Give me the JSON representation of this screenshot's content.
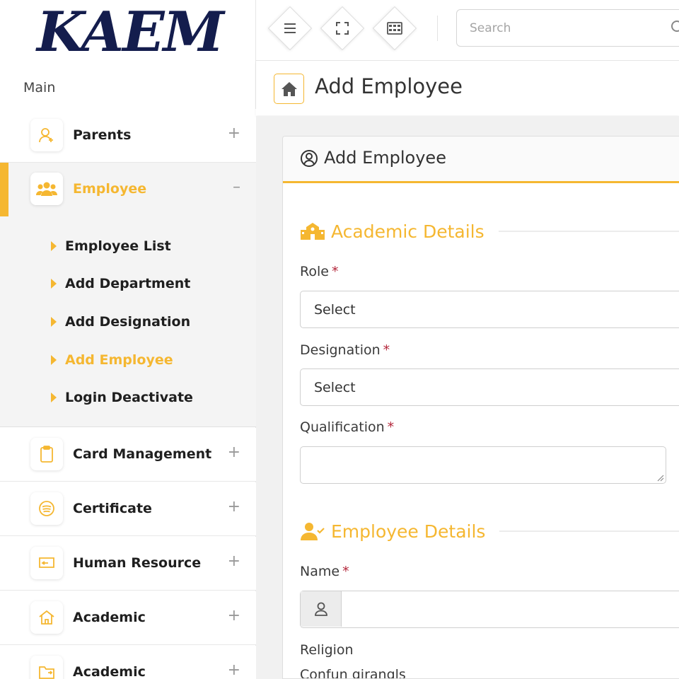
{
  "brand": {
    "logo_text": "KAEM"
  },
  "sidebar": {
    "section_label": "Main",
    "items": [
      {
        "label": "Parents",
        "toggle": "+"
      },
      {
        "label": "Employee",
        "toggle": "–"
      },
      {
        "label": "Card Management",
        "toggle": "+"
      },
      {
        "label": "Certificate",
        "toggle": "+"
      },
      {
        "label": "Human Resource",
        "toggle": "+"
      },
      {
        "label": "Academic",
        "toggle": "+"
      },
      {
        "label": "Academic",
        "toggle": "+"
      }
    ],
    "employee_submenu": [
      {
        "label": "Employee List"
      },
      {
        "label": "Add Department"
      },
      {
        "label": "Add Designation"
      },
      {
        "label": "Add Employee",
        "active": true
      },
      {
        "label": "Login Deactivate"
      }
    ]
  },
  "topbar": {
    "icons": [
      "menu-icon",
      "fullscreen-icon",
      "grid-icon"
    ],
    "search": {
      "placeholder": "Search",
      "value": ""
    }
  },
  "page": {
    "title": "Add Employee"
  },
  "form": {
    "card_title": "Add Employee",
    "sections": [
      {
        "title": "Academic Details",
        "icon": "school-building-icon"
      },
      {
        "title": "Employee Details",
        "icon": "user-check-icon"
      }
    ],
    "fields": {
      "role": {
        "label": "Role",
        "required": "*",
        "value": "Select"
      },
      "designation": {
        "label": "Designation",
        "required": "*",
        "value": "Select"
      },
      "qualification": {
        "label": "Qualification",
        "required": "*",
        "value": ""
      },
      "name": {
        "label": "Name",
        "required": "*",
        "value": ""
      },
      "religion": {
        "label": "Religion"
      }
    },
    "cutoff_text": "Confun girangls"
  },
  "colors": {
    "accent": "#f5b731",
    "logo": "#141d4d",
    "required": "#b3263a"
  }
}
